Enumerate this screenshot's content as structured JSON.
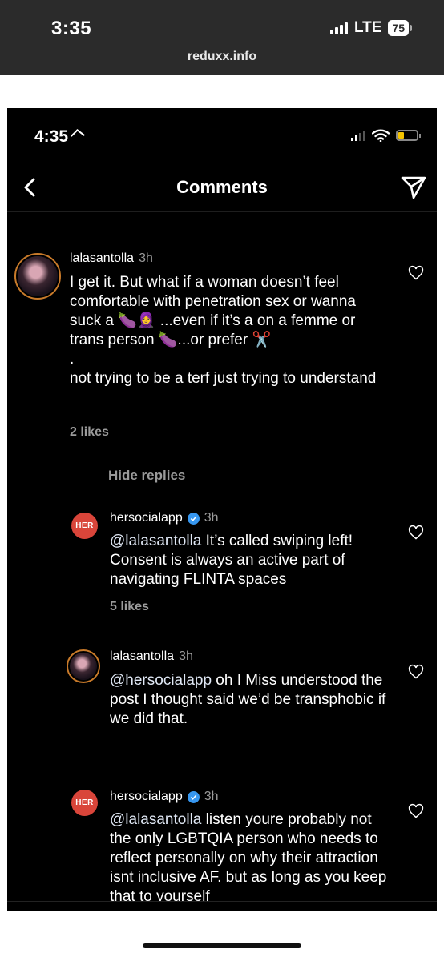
{
  "outer_status": {
    "time": "3:35",
    "network": "LTE",
    "battery": "75",
    "url": "reduxx.info"
  },
  "inner_status": {
    "time": "4:35"
  },
  "header": {
    "title": "Comments"
  },
  "comments": [
    {
      "username": "lalasantolla",
      "time": "3h",
      "text": "I get it. But what if a woman doesn’t feel comfortable with penetration sex  or wanna suck a 🍆🧕 ...even if it’s a on a femme or trans person 🍆...or prefer ✂️\n.\nnot trying to be a terf just trying  to understand",
      "likes": "2 likes"
    }
  ],
  "hide_replies_label": "Hide replies",
  "replies": [
    {
      "username": "hersocialapp",
      "avatar_text": "HER",
      "verified": true,
      "time": "3h",
      "mention": "@lalasantolla",
      "text": " It’s called swiping left! Consent is always an active part of navigating FLINTA spaces",
      "likes": "5 likes"
    },
    {
      "username": "lalasantolla",
      "verified": false,
      "time": "3h",
      "mention": "@hersocialapp",
      "text": " oh I Miss understood the post I thought said we’d be transphobic if we did that.",
      "likes": ""
    },
    {
      "username": "hersocialapp",
      "avatar_text": "HER",
      "verified": true,
      "time": "3h",
      "mention": "@lalasantolla",
      "text": " listen youre  probably not the only LGBTQIA person who needs to reflect personally on why their attraction isnt inclusive AF. but as long as you keep that to yourself",
      "likes": ""
    }
  ],
  "colors": {
    "outer_bar": "#2b2b2b",
    "screen_bg": "#000000",
    "her_badge": "#d9453a",
    "verified": "#3797f0",
    "battery_fill": "#f5c400"
  }
}
